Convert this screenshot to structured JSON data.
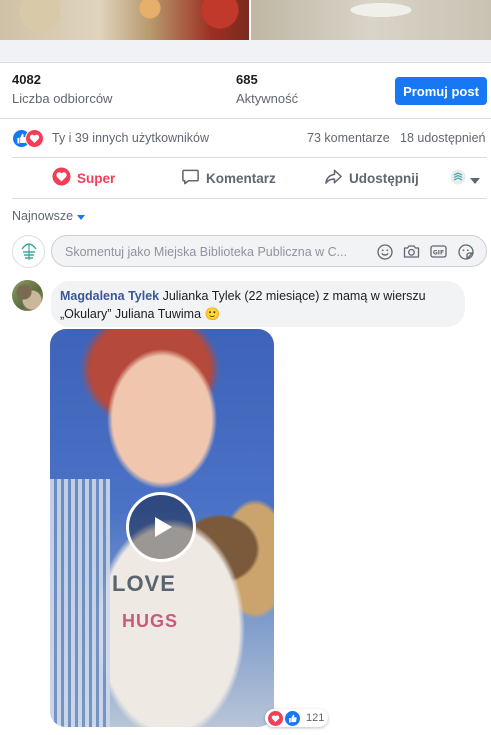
{
  "stats": {
    "reach_value": "4082",
    "reach_label": "Liczba odbiorców",
    "engagement_value": "685",
    "engagement_label": "Aktywność",
    "promote_label": "Promuj post"
  },
  "reactions": {
    "summary": "Ty i 39 innych użytkowników",
    "comments": "73 komentarze",
    "shares": "18 udostępnień",
    "icons": [
      "like-icon",
      "love-icon"
    ]
  },
  "actions": {
    "super": "Super",
    "comment": "Komentarz",
    "share": "Udostępnij"
  },
  "sort": {
    "label": "Najnowsze"
  },
  "composer": {
    "placeholder": "Skomentuj jako Miejska Biblioteka Publiczna w C..."
  },
  "comment": {
    "author": "Magdalena Tylek",
    "text_line1": " Julianka Tylek (22 miesiące) z mamą w wierszu",
    "text_line2": "„Okulary” Juliana Tuwima 🙂",
    "reaction_count": "121"
  },
  "video": {
    "shirt_text_1": "LOVE",
    "shirt_text_2": "HUGS"
  },
  "colors": {
    "accent": "#1877f2",
    "love": "#f33e58",
    "author": "#385898",
    "muted": "#606770"
  }
}
